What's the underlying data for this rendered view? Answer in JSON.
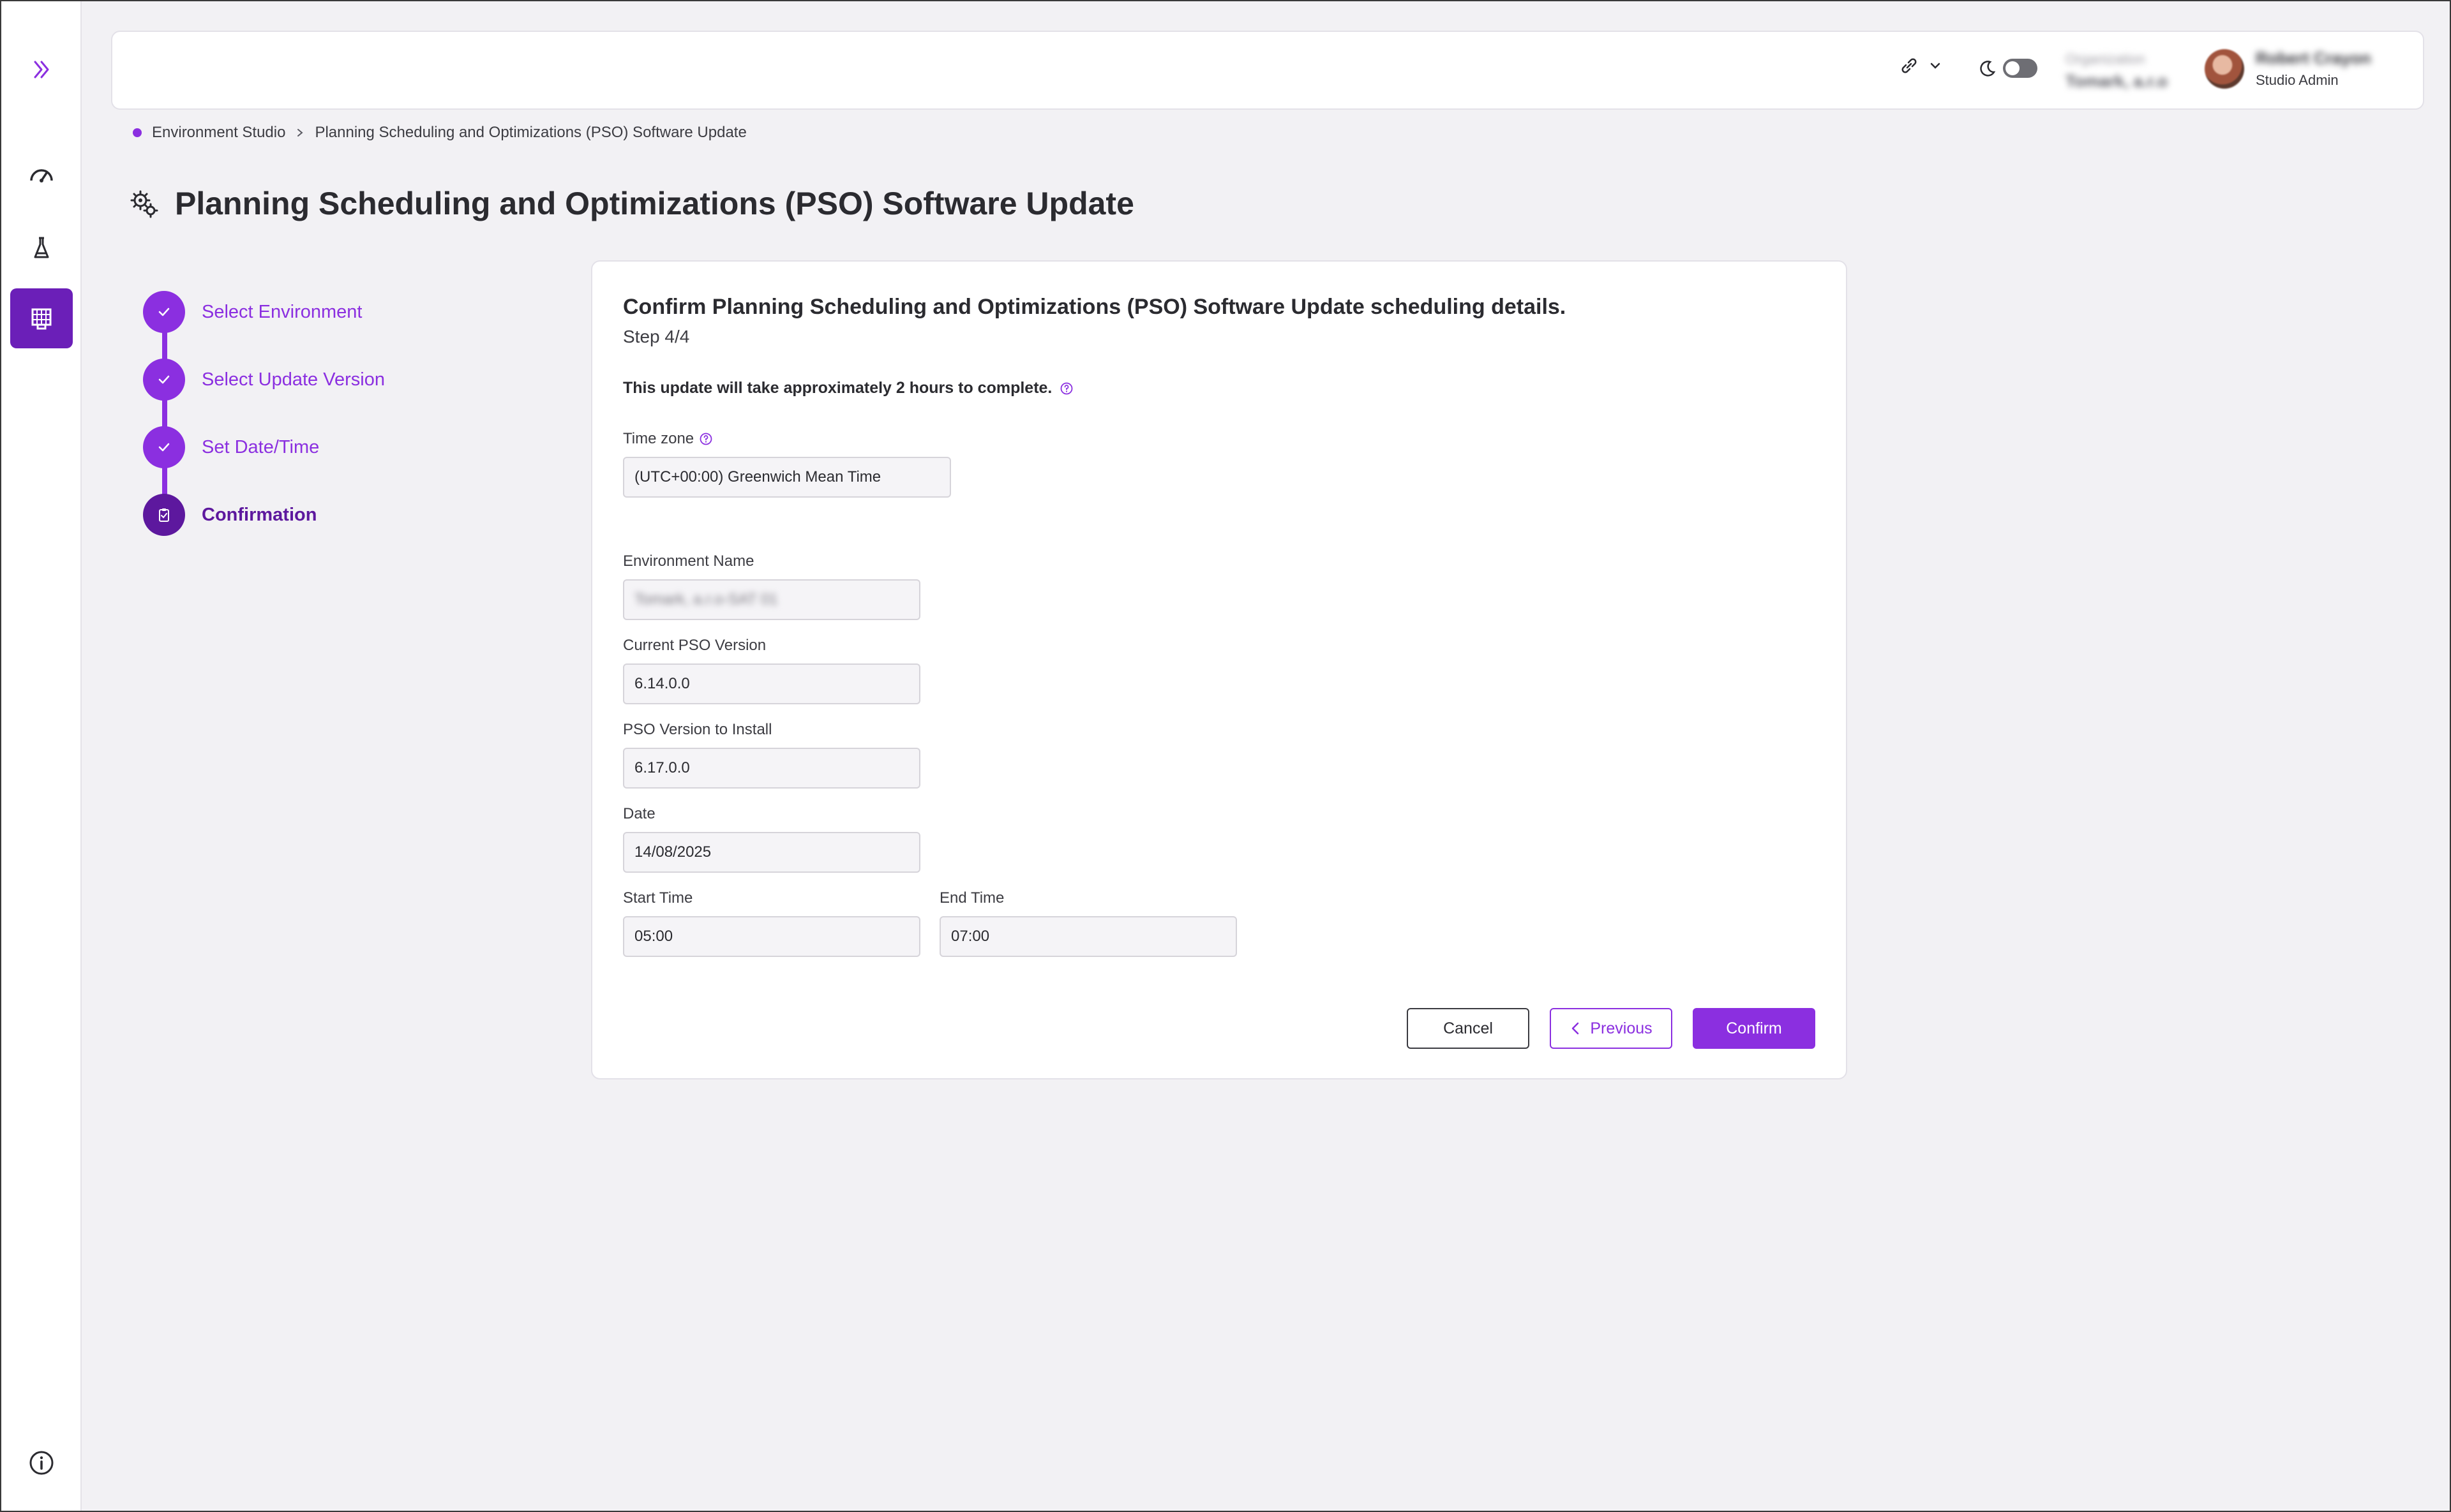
{
  "rail": {
    "items": [
      "expand",
      "dashboard",
      "deployments",
      "environment-studio",
      "info"
    ],
    "active": "environment-studio"
  },
  "header": {
    "organization_label": "Organization",
    "organization_value": "Tomark, a.r.o",
    "user_name": "Robert Crayon",
    "user_role": "Studio Admin"
  },
  "breadcrumb": {
    "items": [
      "Environment Studio",
      "Planning Scheduling and Optimizations (PSO) Software Update"
    ]
  },
  "page": {
    "title": "Planning Scheduling and Optimizations (PSO) Software Update"
  },
  "stepper": {
    "steps": [
      {
        "label": "Select Environment",
        "state": "done"
      },
      {
        "label": "Select Update Version",
        "state": "done"
      },
      {
        "label": "Set Date/Time",
        "state": "done"
      },
      {
        "label": "Confirmation",
        "state": "current"
      }
    ]
  },
  "form": {
    "title": "Confirm Planning Scheduling and Optimizations (PSO) Software Update scheduling details.",
    "step": "Step 4/4",
    "duration_note": "This update will take approximately 2 hours to complete.",
    "timezone_label": "Time zone",
    "timezone_value": "(UTC+00:00) Greenwich Mean Time",
    "env_name_label": "Environment Name",
    "env_name_value": "Tomark, a.r.o-SAT 01",
    "current_version_label": "Current PSO Version",
    "current_version_value": "6.14.0.0",
    "install_version_label": "PSO Version to Install",
    "install_version_value": "6.17.0.0",
    "date_label": "Date",
    "date_value": "14/08/2025",
    "start_label": "Start Time",
    "start_value": "05:00",
    "end_label": "End Time",
    "end_value": "07:00"
  },
  "actions": {
    "cancel": "Cancel",
    "previous": "Previous",
    "confirm": "Confirm"
  },
  "colors": {
    "accent": "#8b2fe0",
    "accent_dark": "#5d189e",
    "rail_active": "#6b1fb8",
    "background": "#f2f1f4"
  }
}
